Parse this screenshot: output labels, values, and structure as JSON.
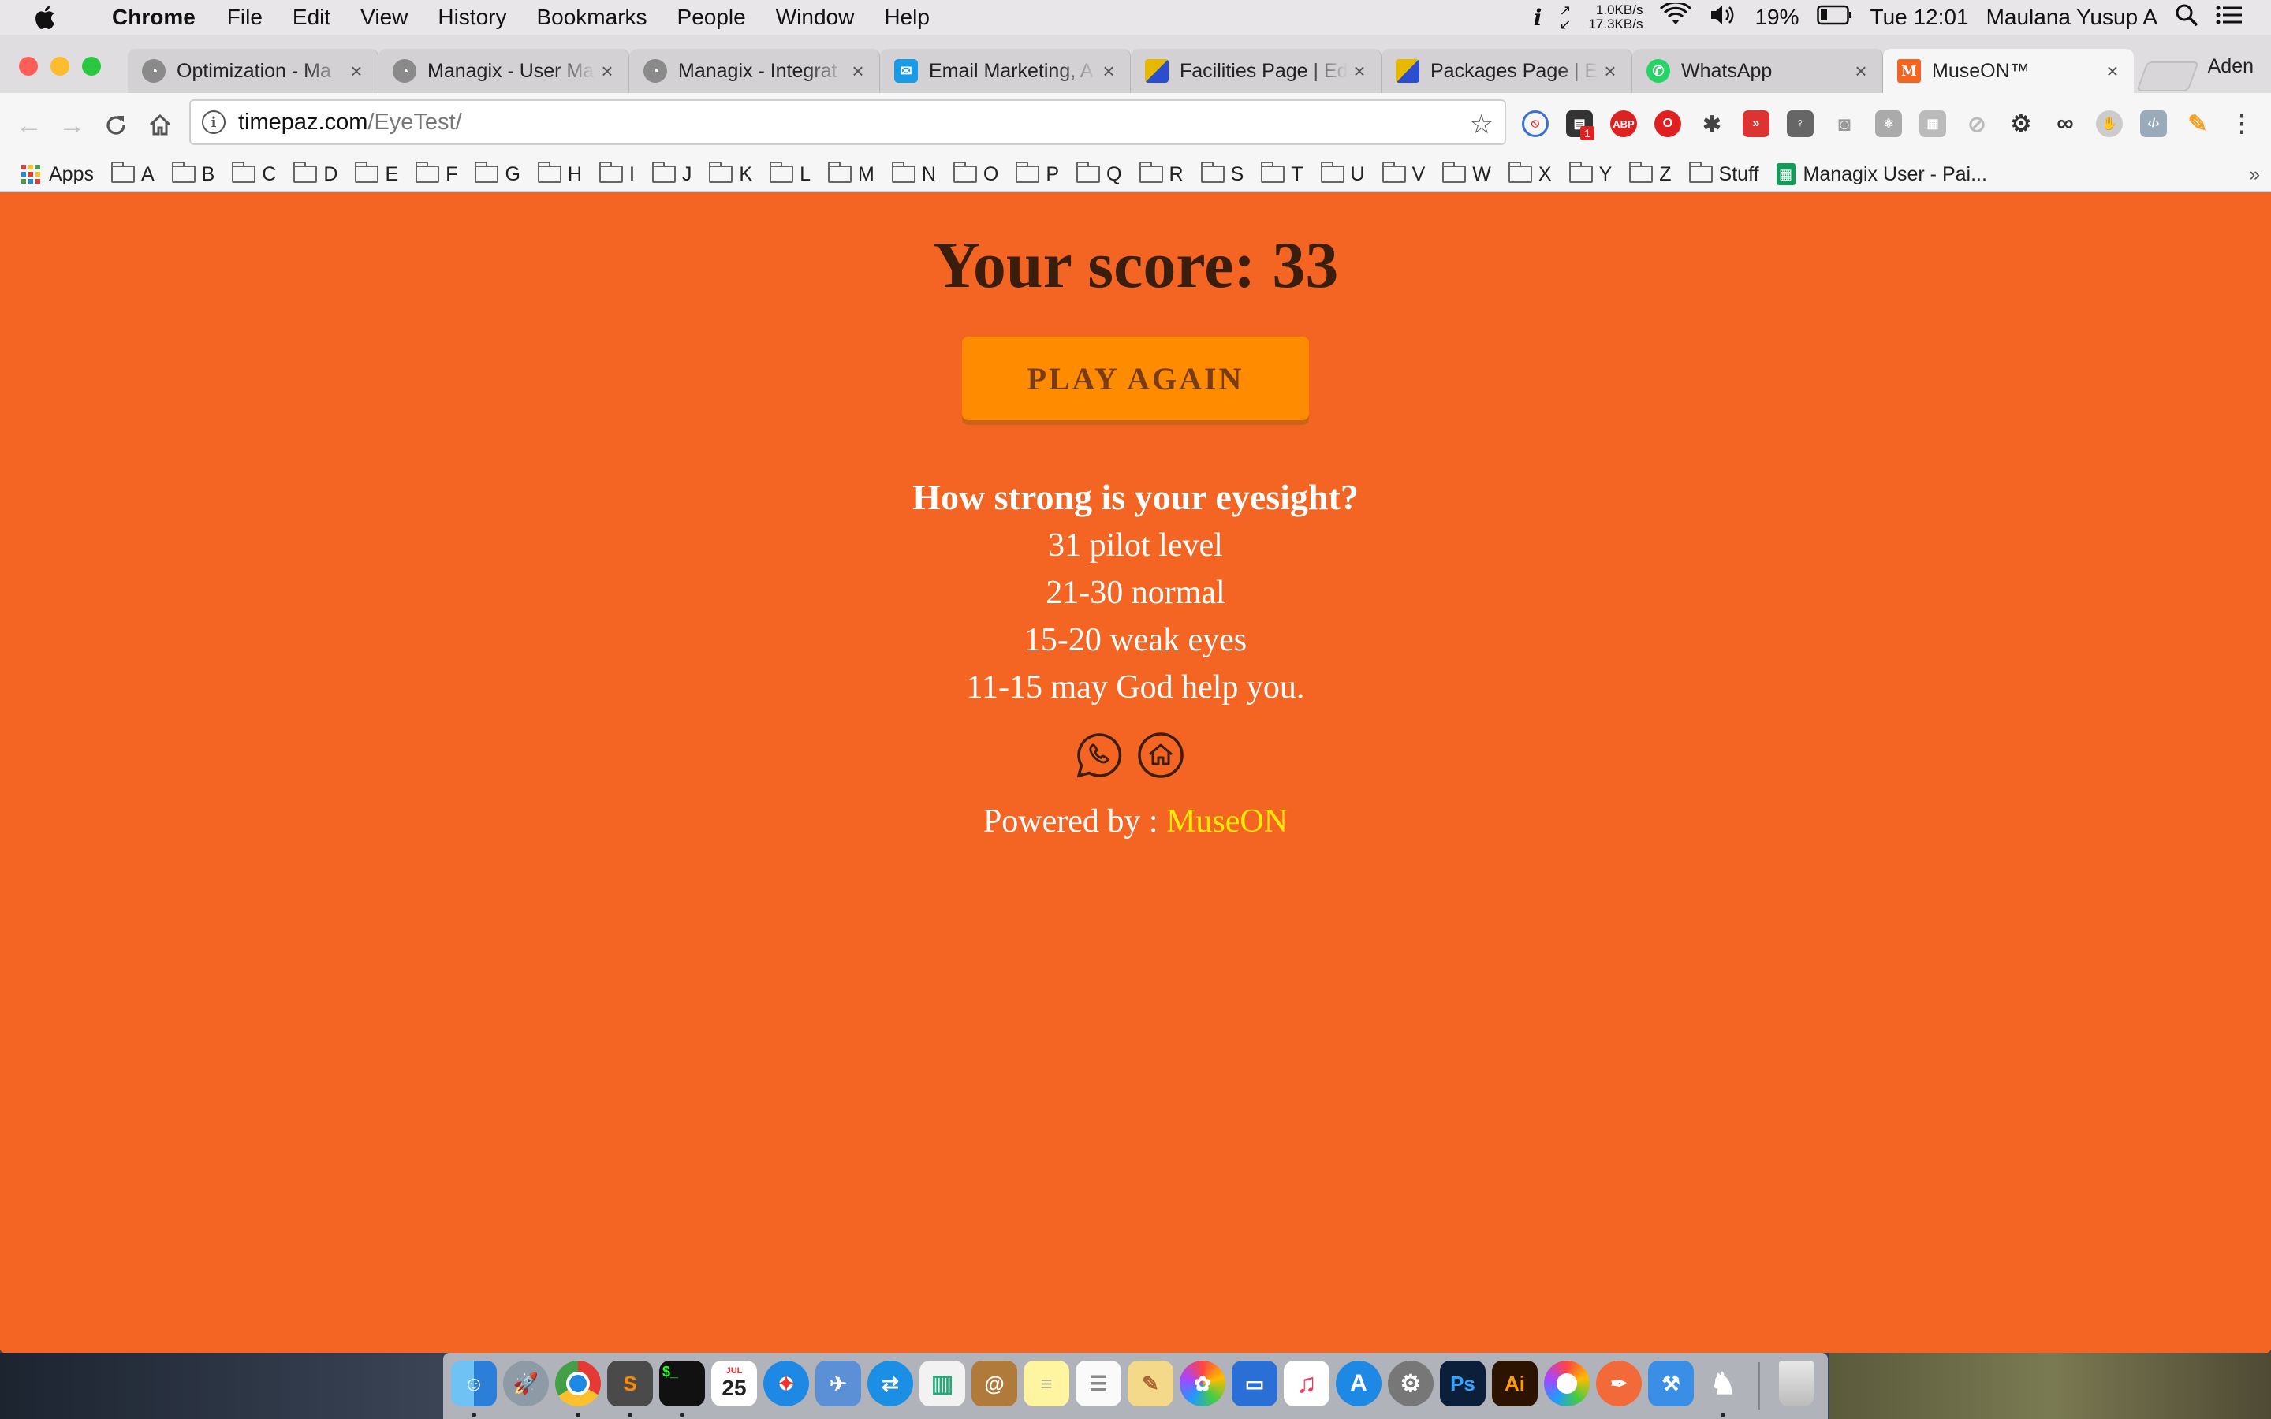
{
  "menubar": {
    "app": "Chrome",
    "menus": [
      "File",
      "Edit",
      "View",
      "History",
      "Bookmarks",
      "People",
      "Window",
      "Help"
    ],
    "net_up": "1.0KB/s",
    "net_down": "17.3KB/s",
    "battery": "19%",
    "clock": "Tue 12:01",
    "user": "Maulana Yusup A"
  },
  "tabs": [
    {
      "title": "Optimization - Ma",
      "icon": "managix-icon",
      "color": "#8a8a8a"
    },
    {
      "title": "Managix - User Ma",
      "icon": "managix-icon",
      "color": "#8a8a8a"
    },
    {
      "title": "Managix - Integrat",
      "icon": "managix-icon",
      "color": "#8a8a8a"
    },
    {
      "title": "Email Marketing, A",
      "icon": "mail-icon",
      "color": "#1a9be6"
    },
    {
      "title": "Facilities Page | Ed",
      "icon": "cube-icon",
      "color": "#e6b800"
    },
    {
      "title": "Packages Page | E",
      "icon": "cube-icon",
      "color": "#e6b800"
    },
    {
      "title": "WhatsApp",
      "icon": "whatsapp-icon",
      "color": "#25d366"
    },
    {
      "title": "MuseON™",
      "icon": "museon-icon",
      "color": "#f46524",
      "active": true
    }
  ],
  "profile": "Aden",
  "address": {
    "host": "timepaz.com",
    "path": "/EyeTest/"
  },
  "bookmarks": {
    "apps": "Apps",
    "folders": [
      "A",
      "B",
      "C",
      "D",
      "E",
      "F",
      "G",
      "H",
      "I",
      "J",
      "K",
      "L",
      "M",
      "N",
      "O",
      "P",
      "Q",
      "R",
      "S",
      "T",
      "U",
      "V",
      "W",
      "X",
      "Y",
      "Z",
      "Stuff"
    ],
    "sheet": "Managix User - Pai...",
    "more": "»"
  },
  "game": {
    "score_text": "Your score: 33",
    "play_again": "PLAY AGAIN",
    "question": "How strong is your eyesight?",
    "levels": [
      "31 pilot level",
      "21-30 normal",
      "15-20 weak eyes",
      "11-15 may God help you."
    ],
    "powered_prefix": "Powered by : ",
    "powered_brand": "MuseON"
  },
  "dock": {
    "calendar_day": "25",
    "calendar_month": "JUL"
  },
  "colors": {
    "page_bg": "#f46524",
    "button_bg": "#ff8c00",
    "brand_link": "#ffec00"
  }
}
